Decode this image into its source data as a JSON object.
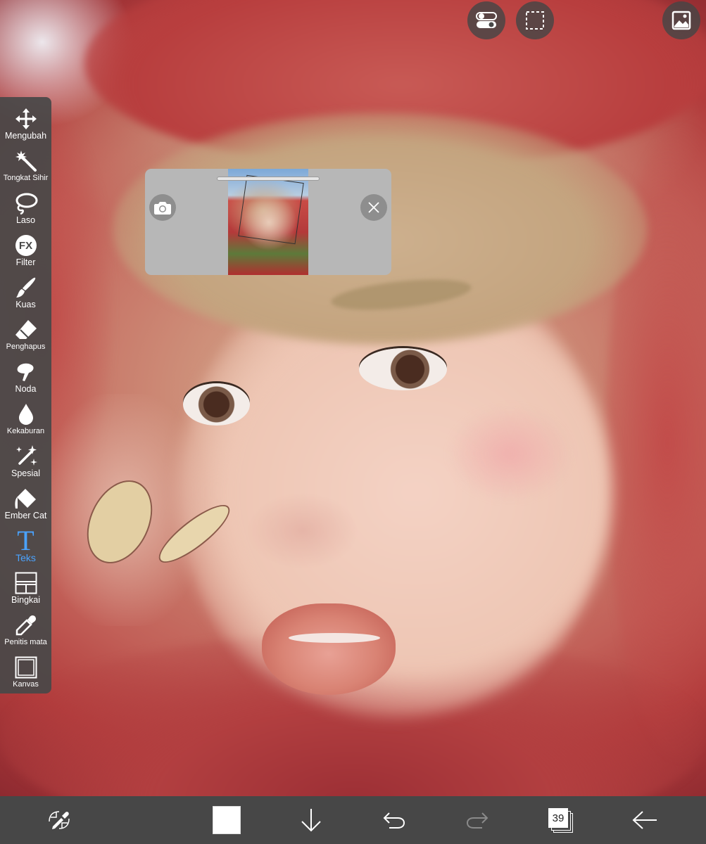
{
  "tools": [
    {
      "label": "Mengubah",
      "icon": "move-icon"
    },
    {
      "label": "Tongkat Sihir",
      "icon": "magic-wand-icon"
    },
    {
      "label": "Laso",
      "icon": "lasso-icon"
    },
    {
      "label": "Filter",
      "icon": "fx-filter-icon",
      "glyph": "FX"
    },
    {
      "label": "Kuas",
      "icon": "brush-icon"
    },
    {
      "label": "Penghapus",
      "icon": "eraser-icon"
    },
    {
      "label": "Noda",
      "icon": "smudge-icon"
    },
    {
      "label": "Kekaburan",
      "icon": "blur-drop-icon"
    },
    {
      "label": "Spesial",
      "icon": "special-sparkle-icon"
    },
    {
      "label": "Ember Cat",
      "icon": "paint-bucket-icon"
    },
    {
      "label": "Teks",
      "icon": "text-icon",
      "glyph": "T",
      "active": true
    },
    {
      "label": "Bingkai",
      "icon": "frame-divider-icon"
    },
    {
      "label": "Penitis mata",
      "icon": "eyedropper-icon"
    },
    {
      "label": "Kanvas",
      "icon": "canvas-icon"
    }
  ],
  "bottom_bar": {
    "layers_count": "39",
    "current_color": "#ffffff"
  },
  "colors": {
    "active_tool": "#4aa3ff",
    "panel": "#484848",
    "bar": "#474747"
  }
}
